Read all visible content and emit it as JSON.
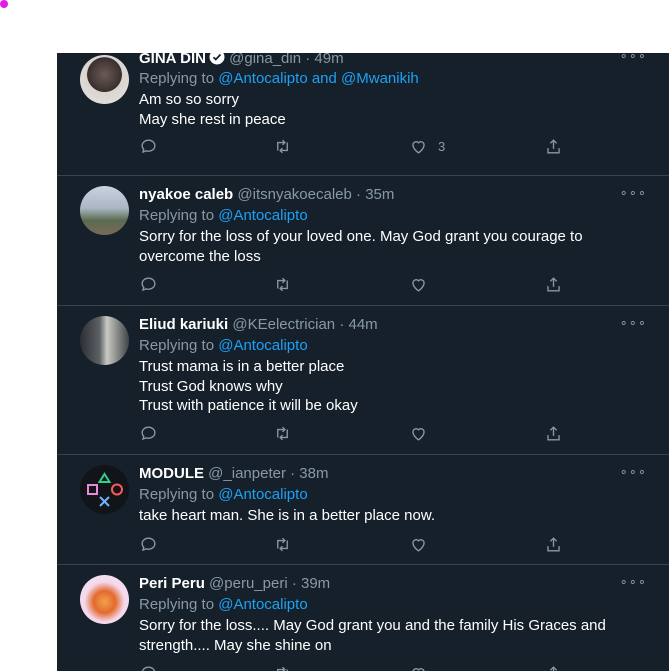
{
  "colors": {
    "background": "#15202b",
    "divider": "#38444d",
    "text": "#ffffff",
    "muted": "#8899a6",
    "link": "#1da1f2"
  },
  "reply_prefix": "Replying to",
  "more_label": "∘∘∘",
  "tweets": [
    {
      "name": "GINA DIN",
      "verified": true,
      "handle": "@gina_din",
      "time": "· 49m",
      "reply_to": "@Antocalipto and @Mwanikih",
      "lines": [
        "Am so so sorry",
        "May she rest in peace"
      ],
      "like_count": "3"
    },
    {
      "name": "nyakoe caleb",
      "handle": "@itsnyakoecaleb",
      "time": "· 35m",
      "reply_to": "@Antocalipto",
      "lines": [
        "Sorry for the loss of your loved one. May God grant you courage to",
        "overcome the loss"
      ]
    },
    {
      "name": "Eliud kariuki",
      "handle": "@KEelectrician",
      "time": "· 44m",
      "reply_to": "@Antocalipto",
      "lines": [
        "Trust mama is in a better place",
        "Trust God knows why",
        "Trust with patience it will be okay"
      ]
    },
    {
      "name": "MODULE",
      "handle": "@_ianpeter",
      "time": "· 38m",
      "reply_to": "@Antocalipto",
      "lines": [
        "take heart man. She is in a better place now."
      ]
    },
    {
      "name": "Peri Peru",
      "handle": "@peru_peri",
      "time": "· 39m",
      "reply_to": "@Antocalipto",
      "lines": [
        "Sorry for the loss.... May God grant you and the family His Graces and",
        "strength.... May she shine on"
      ]
    }
  ]
}
